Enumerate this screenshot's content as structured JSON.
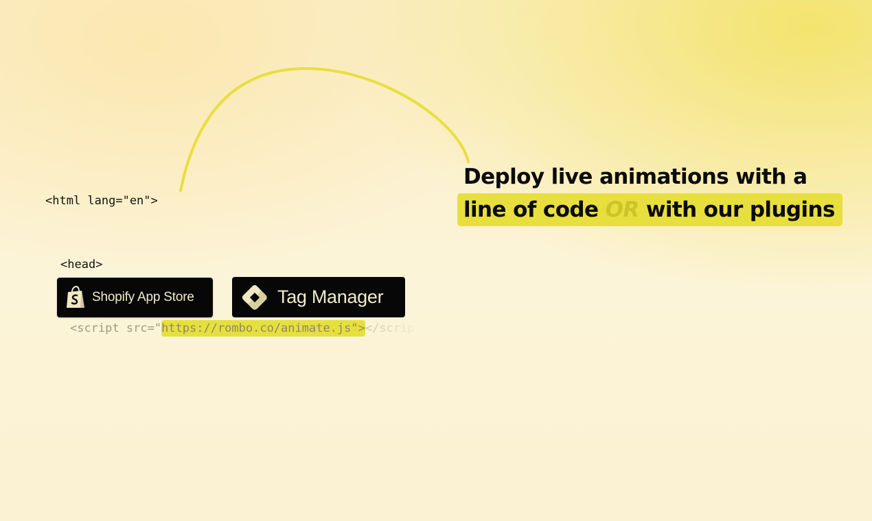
{
  "code": {
    "line1": "<html lang=\"en\">",
    "line2": "<head>",
    "line3_prefix": "<script src=\"",
    "line3_url": "https://rombo.co/animate.js\">",
    "line3_suffix": "</scrip"
  },
  "headline": {
    "line1": "Deploy live animations with a",
    "line2_start": "line of code ",
    "line2_or": "OR",
    "line2_end": " with our plugins"
  },
  "buttons": {
    "shopify_label": "Shopify App Store",
    "tag_label": "Tag Manager"
  },
  "icons": {
    "shopify": "shopify-bag-icon",
    "tag_manager": "tag-manager-diamond-icon"
  },
  "colors": {
    "highlight": "#e7df3e",
    "button_bg": "#070707",
    "button_text": "#f3edc8"
  }
}
